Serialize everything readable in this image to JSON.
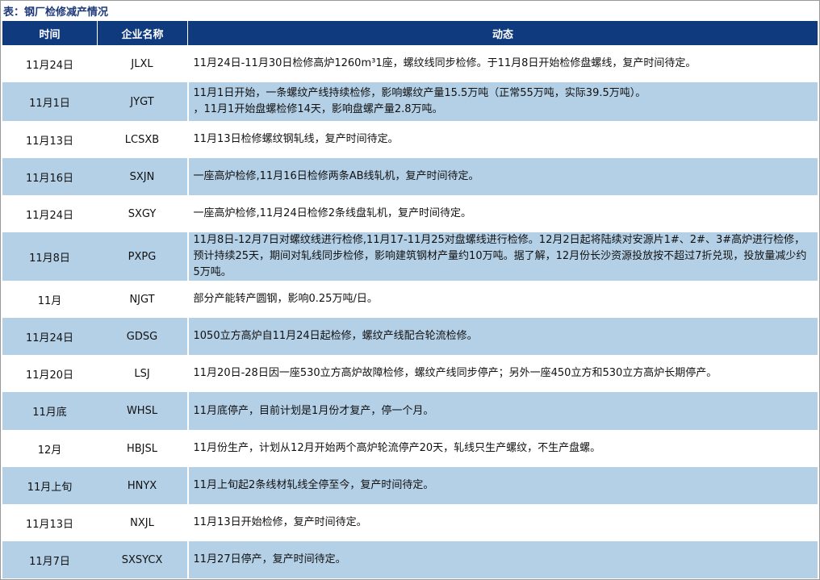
{
  "title": "表：钢厂检修减产情况",
  "headers": [
    "时间",
    "企业名称",
    "动态"
  ],
  "rows": [
    {
      "time": "11月24日",
      "company": "JLXL",
      "status": "11月24日-11月30日检修高炉1260m³1座，螺纹线同步检修。于11月8日开始检修盘螺线，复产时间待定。"
    },
    {
      "time": "11月1日",
      "company": "JYGT",
      "status": "11月1日开始，一条螺纹产线持续检修，影响螺纹产量15.5万吨（正常55万吨，实际39.5万吨）。\n，11月1开始盘螺检修14天，影响盘螺产量2.8万吨。"
    },
    {
      "time": "11月13日",
      "company": "LCSXB",
      "status": "11月13日检修螺纹钢轧线，复产时间待定。"
    },
    {
      "time": "11月16日",
      "company": "SXJN",
      "status": "一座高炉检修,11月16日检修两条AB线轧机，复产时间待定。"
    },
    {
      "time": "11月24日",
      "company": "SXGY",
      "status": "一座高炉检修,11月24日检修2条线盘轧机，复产时间待定。"
    },
    {
      "time": "11月8日",
      "company": "PXPG",
      "status": "11月8日-12月7日对螺纹线进行检修,11月17-11月25对盘螺线进行检修。12月2日起将陆续对安源片1#、2#、3#高炉进行检修，预计持续25天，期间对轧线同步检修，影响建筑钢材产量约10万吨。据了解，12月份长沙资源投放按不超过7折兑现，投放量减少约5万吨。"
    },
    {
      "time": "11月",
      "company": "NJGT",
      "status": "部分产能转产圆钢，影响0.25万吨/日。"
    },
    {
      "time": "11月24日",
      "company": "GDSG",
      "status": "1050立方高炉自11月24日起检修，螺纹产线配合轮流检修。"
    },
    {
      "time": "11月20日",
      "company": "LSJ",
      "status": "11月20日-28日因一座530立方高炉故障检修，螺纹产线同步停产；另外一座450立方和530立方高炉长期停产。"
    },
    {
      "time": "11月底",
      "company": "WHSL",
      "status": "11月底停产，目前计划是1月份才复产，停一个月。"
    },
    {
      "time": "12月",
      "company": "HBJSL",
      "status": "11月份生产，计划从12月开始两个高炉轮流停产20天，轧线只生产螺纹，不生产盘螺。"
    },
    {
      "time": "11月上旬",
      "company": "HNYX",
      "status": "11月上旬起2条线材轧线全停至今，复产时间待定。"
    },
    {
      "time": "11月13日",
      "company": "NXJL",
      "status": "11月13日开始检修，复产时间待定。"
    },
    {
      "time": "11月7日",
      "company": "SXSYCX",
      "status": "11月27日停产，复产时间待定。"
    }
  ]
}
